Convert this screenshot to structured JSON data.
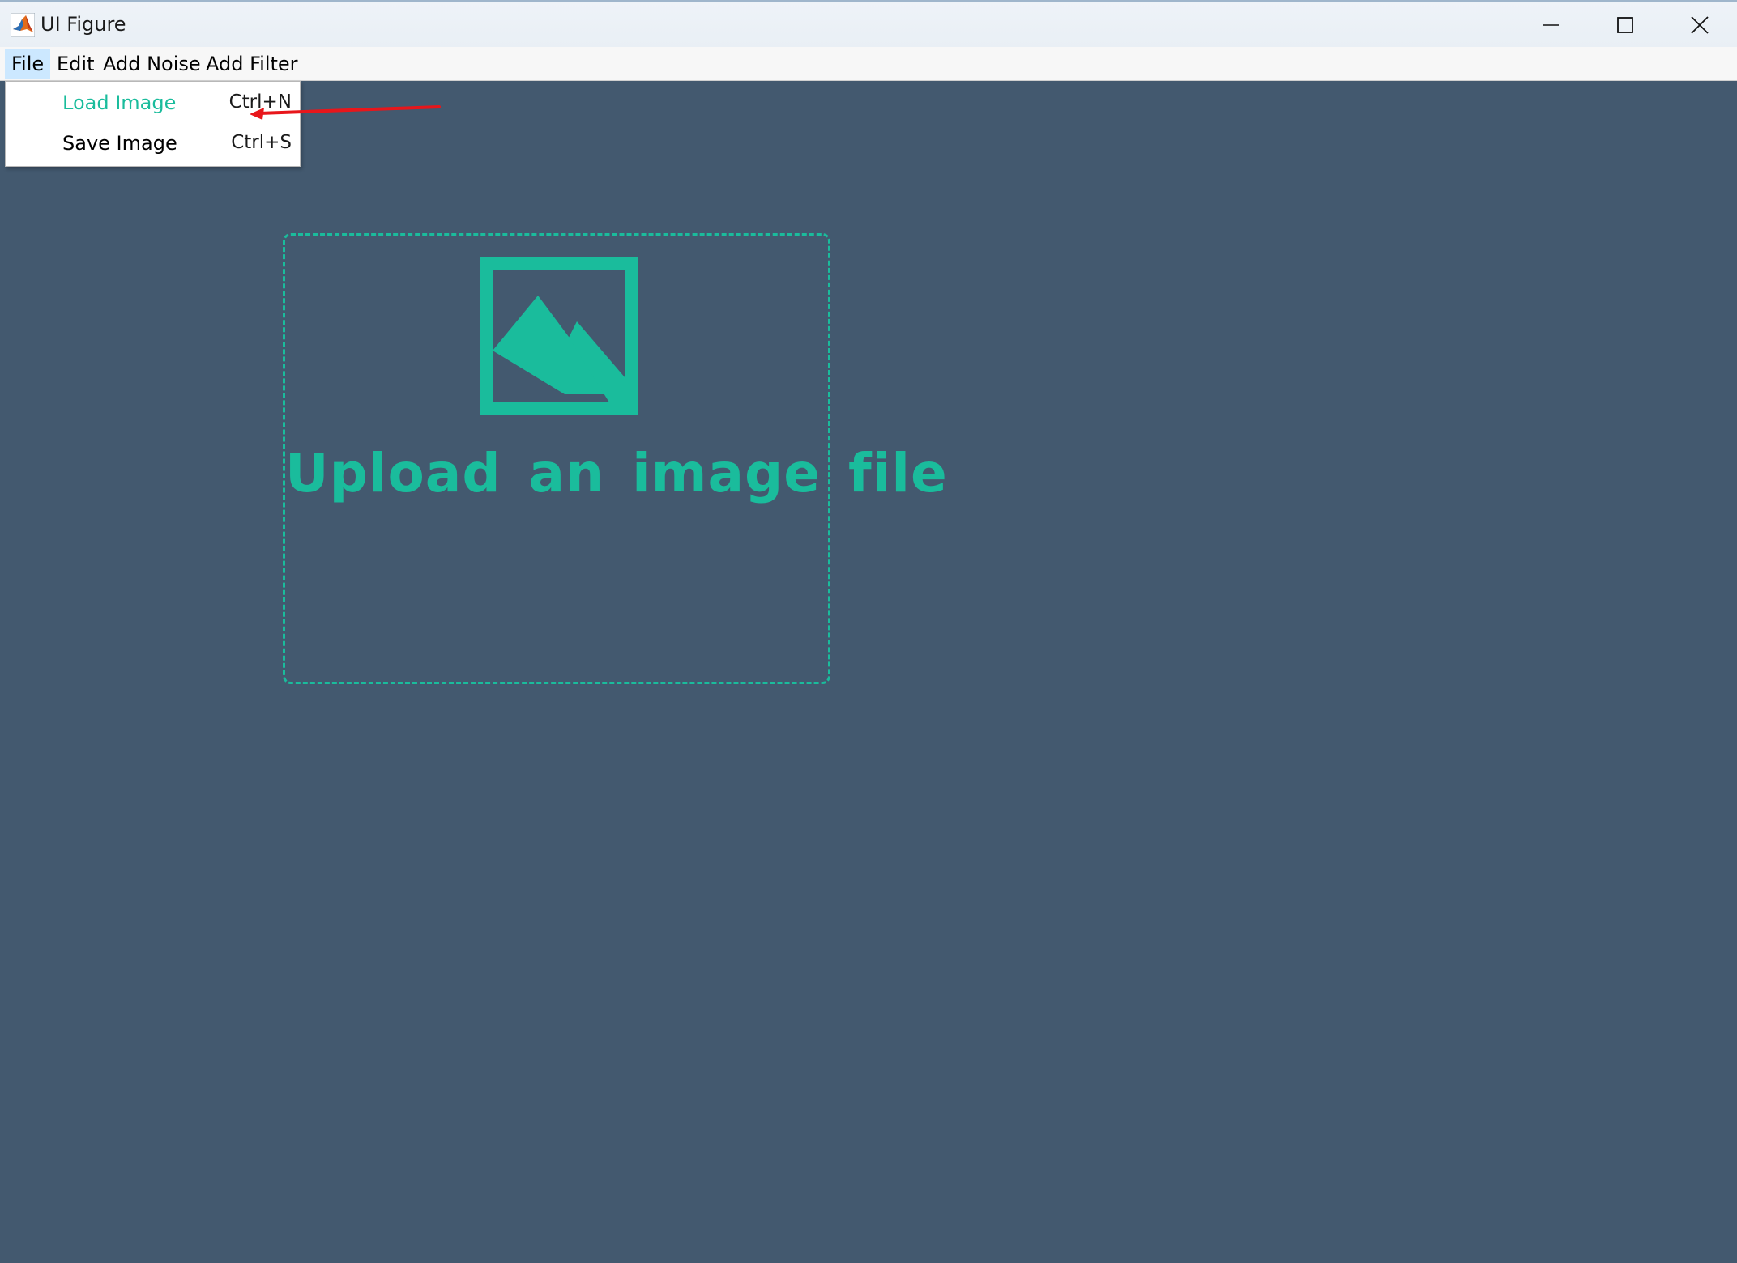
{
  "window": {
    "title": "UI Figure",
    "icon": "matlab-icon",
    "controls": [
      "minimize-icon",
      "maximize-icon",
      "close-icon"
    ]
  },
  "menubar": {
    "items": [
      {
        "label": "File",
        "active": true
      },
      {
        "label": "Edit"
      },
      {
        "label": "Add Noise"
      },
      {
        "label": "Add Filter"
      }
    ]
  },
  "file_menu": {
    "items": [
      {
        "label": "Load Image",
        "shortcut": "Ctrl+N",
        "highlighted": true
      },
      {
        "label": "Save Image",
        "shortcut": "Ctrl+S"
      }
    ]
  },
  "upload_panel": {
    "icon": "image-icon",
    "text": "Upload an image file"
  },
  "colors": {
    "background": "#43596f",
    "accent": "#1abc9c",
    "menu_active": "#cce8ff",
    "annotation": "#e8161b"
  }
}
